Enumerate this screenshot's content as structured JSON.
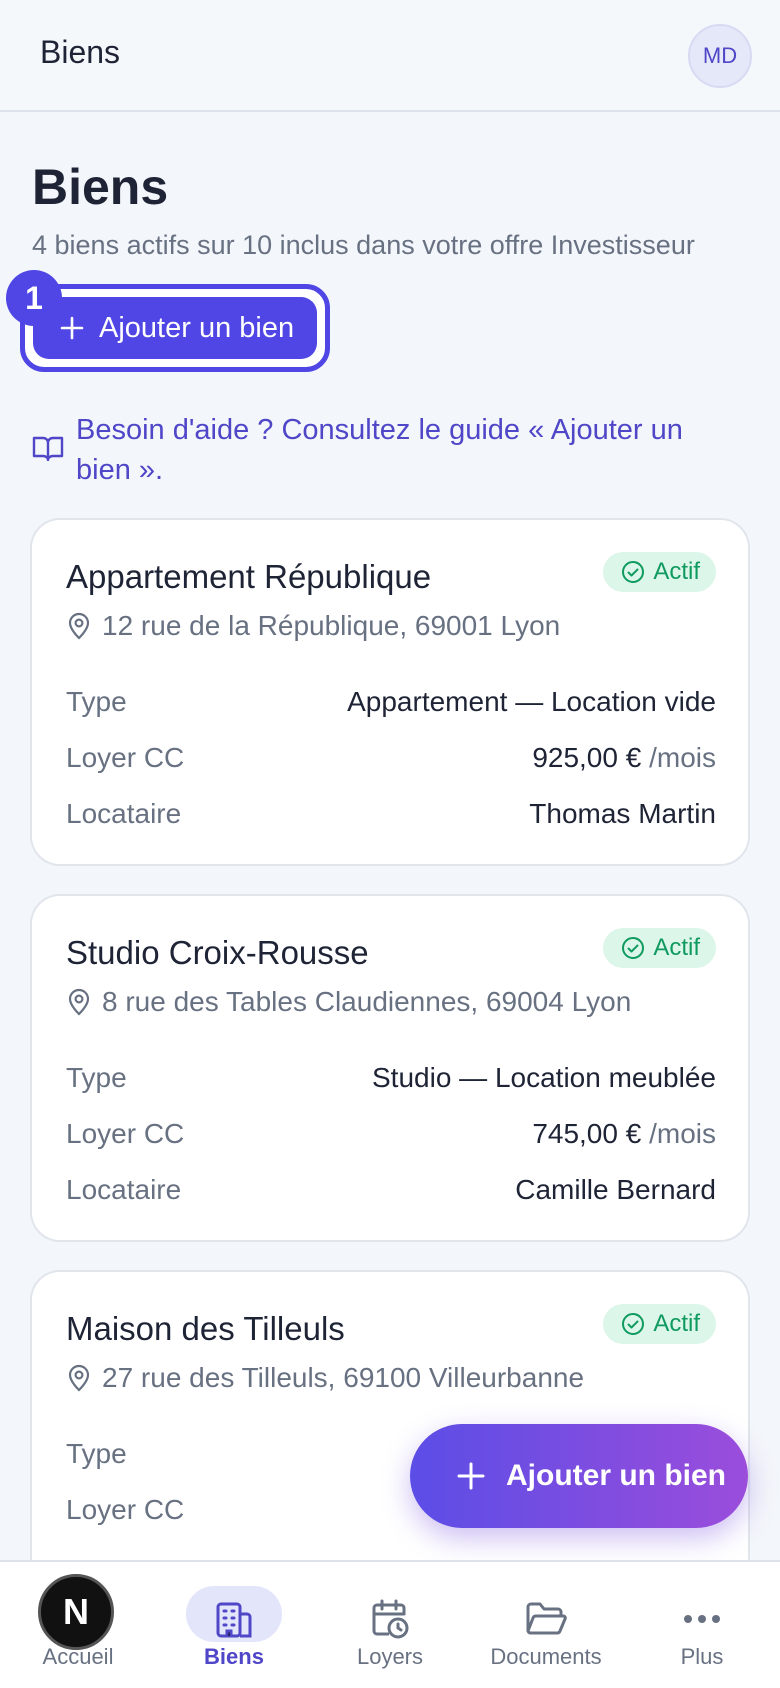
{
  "header": {
    "title": "Biens",
    "avatar_initials": "MD"
  },
  "page": {
    "title": "Biens",
    "subtitle": "4 biens actifs sur 10 inclus dans votre offre Investisseur",
    "add_button_label": "Ajouter un bien",
    "step_number": "1",
    "help_text": "Besoin d'aide ? Consultez le guide « Ajouter un bien »."
  },
  "labels": {
    "type": "Type",
    "rent": "Loyer CC",
    "tenant": "Locataire",
    "per_month": "/mois"
  },
  "properties": [
    {
      "name": "Appartement République",
      "status": "Actif",
      "address": "12 rue de la République, 69001 Lyon",
      "type": "Appartement — Location vide",
      "rent": "925,00 €",
      "tenant": "Thomas Martin"
    },
    {
      "name": "Studio Croix-Rousse",
      "status": "Actif",
      "address": "8 rue des Tables Claudiennes, 69004 Lyon",
      "type": "Studio — Location meublée",
      "rent": "745,00 €",
      "tenant": "Camille Bernard"
    },
    {
      "name": "Maison des Tilleuls",
      "status": "Actif",
      "address": "27 rue des Tilleuls, 69100 Villeurbanne",
      "type": "",
      "rent": "",
      "tenant": ""
    }
  ],
  "fab": {
    "label": "Ajouter un bien"
  },
  "nav": {
    "items": [
      {
        "label": "Accueil",
        "icon": "home-icon"
      },
      {
        "label": "Biens",
        "icon": "building-icon"
      },
      {
        "label": "Loyers",
        "icon": "calendar-clock-icon"
      },
      {
        "label": "Documents",
        "icon": "folder-icon"
      },
      {
        "label": "Plus",
        "icon": "more-icon"
      }
    ]
  },
  "colors": {
    "accent": "#4f46e5",
    "success_bg": "#dcf7ea",
    "success_text": "#0f9a5f"
  }
}
